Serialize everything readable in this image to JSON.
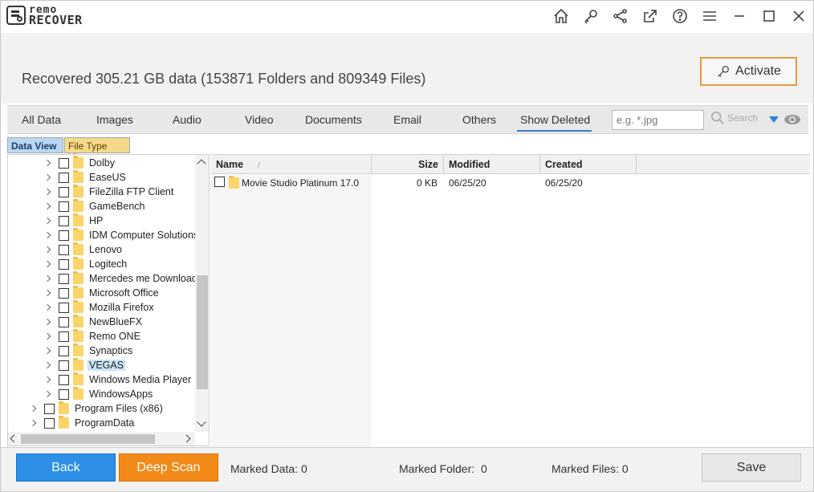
{
  "app": {
    "logo_line1": "remo",
    "logo_line2": "RECOVER"
  },
  "titlebar_icons": [
    "home-icon",
    "key-icon",
    "share-icon",
    "external-link-icon",
    "help-icon",
    "menu-icon",
    "minimize-icon",
    "maximize-icon",
    "close-icon"
  ],
  "header": {
    "recovered_text": "Recovered 305.21 GB data (153871 Folders and 809349 Files)",
    "activate_label": "Activate"
  },
  "tabs": [
    {
      "label": "All Data"
    },
    {
      "label": "Images"
    },
    {
      "label": "Audio"
    },
    {
      "label": "Video"
    },
    {
      "label": "Documents"
    },
    {
      "label": "Email"
    },
    {
      "label": "Others"
    },
    {
      "label": "Show Deleted",
      "active": true
    }
  ],
  "search": {
    "placeholder": "e.g. *.jpg",
    "button_label": "Search"
  },
  "view_tabs": {
    "data_view": "Data View",
    "file_type_view": "File Type View"
  },
  "tree": {
    "items": [
      {
        "label": "Dolby"
      },
      {
        "label": "EaseUS"
      },
      {
        "label": "FileZilla FTP Client"
      },
      {
        "label": "GameBench"
      },
      {
        "label": "HP"
      },
      {
        "label": "IDM Computer Solutions"
      },
      {
        "label": "Lenovo"
      },
      {
        "label": "Logitech"
      },
      {
        "label": "Mercedes me Download M"
      },
      {
        "label": "Microsoft Office"
      },
      {
        "label": "Mozilla Firefox"
      },
      {
        "label": "NewBlueFX"
      },
      {
        "label": "Remo ONE"
      },
      {
        "label": "Synaptics"
      },
      {
        "label": "VEGAS",
        "selected": true
      },
      {
        "label": "Windows Media Player"
      },
      {
        "label": "WindowsApps"
      },
      {
        "label": "Program Files (x86)",
        "level": 0
      },
      {
        "label": "ProgramData",
        "level": 0
      }
    ]
  },
  "list": {
    "columns": {
      "name": "Name",
      "size": "Size",
      "modified": "Modified",
      "created": "Created"
    },
    "rows": [
      {
        "name": "Movie Studio Platinum 17.0",
        "size": "0 KB",
        "modified": "06/25/20",
        "created": "06/25/20"
      }
    ]
  },
  "footer": {
    "back_label": "Back",
    "deep_scan_label": "Deep Scan",
    "marked_data_label": "Marked Data:",
    "marked_data_value": "0",
    "marked_folder_label": "Marked Folder:",
    "marked_folder_value": "0",
    "marked_files_label": "Marked Files:",
    "marked_files_value": "0",
    "save_label": "Save"
  },
  "colors": {
    "accent_blue": "#2d8fe6",
    "accent_orange": "#f28a1a",
    "activate_border": "#e89a3c"
  }
}
